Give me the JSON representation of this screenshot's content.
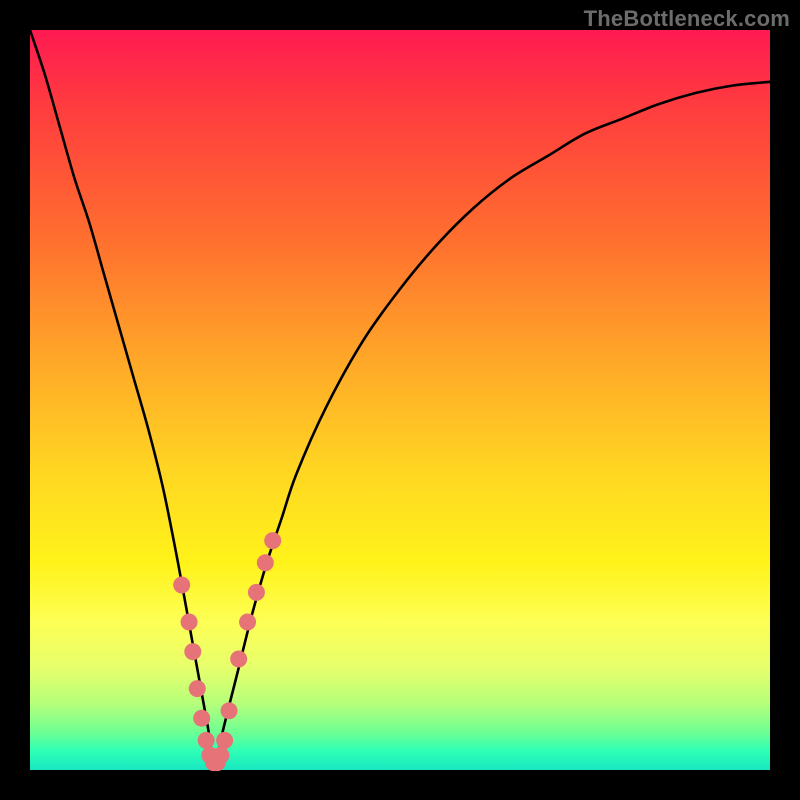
{
  "watermark": {
    "text": "TheBottleneck.com"
  },
  "colors": {
    "frame": "#000000",
    "curve": "#000000",
    "marker_fill": "#e57378",
    "marker_stroke": "#d85c62"
  },
  "chart_data": {
    "type": "line",
    "title": "",
    "xlabel": "",
    "ylabel": "",
    "xlim": [
      0,
      100
    ],
    "ylim": [
      0,
      100
    ],
    "grid": false,
    "legend": false,
    "x": [
      0,
      2,
      4,
      6,
      8,
      10,
      12,
      14,
      16,
      18,
      20,
      22,
      24,
      25,
      26,
      28,
      30,
      32,
      34,
      36,
      40,
      45,
      50,
      55,
      60,
      65,
      70,
      75,
      80,
      85,
      90,
      95,
      100
    ],
    "y": [
      100,
      94,
      87,
      80,
      74,
      67,
      60,
      53,
      46,
      38,
      28,
      17,
      6,
      0,
      5,
      13,
      21,
      28,
      34,
      40,
      49,
      58,
      65,
      71,
      76,
      80,
      83,
      86,
      88,
      90,
      91.5,
      92.5,
      93
    ],
    "markers": {
      "x": [
        20.5,
        21.5,
        22.0,
        22.6,
        23.2,
        23.8,
        24.3,
        24.8,
        25.3,
        25.8,
        26.3,
        26.9,
        28.2,
        29.4,
        30.6,
        31.8,
        32.8
      ],
      "y": [
        25,
        20,
        16,
        11,
        7,
        4,
        2,
        1,
        1,
        2,
        4,
        8,
        15,
        20,
        24,
        28,
        31
      ]
    }
  }
}
